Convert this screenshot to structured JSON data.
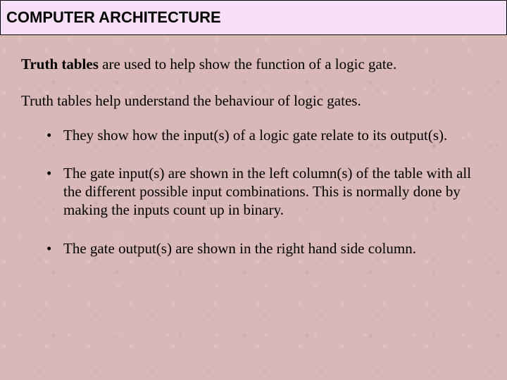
{
  "header": {
    "title": "COMPUTER ARCHITECTURE"
  },
  "body": {
    "intro_bold": "Truth tables ",
    "intro_rest": "are used to help show the function of a logic gate.",
    "subline": "Truth tables help understand the behaviour of logic gates.",
    "bullets": [
      "They show how the input(s) of a logic gate relate to its output(s).",
      "The gate input(s) are shown in the left column(s) of the table with all the different possible input combinations. This is normally done by making the inputs count up in binary.",
      "The gate output(s) are shown in the right hand side column."
    ]
  }
}
